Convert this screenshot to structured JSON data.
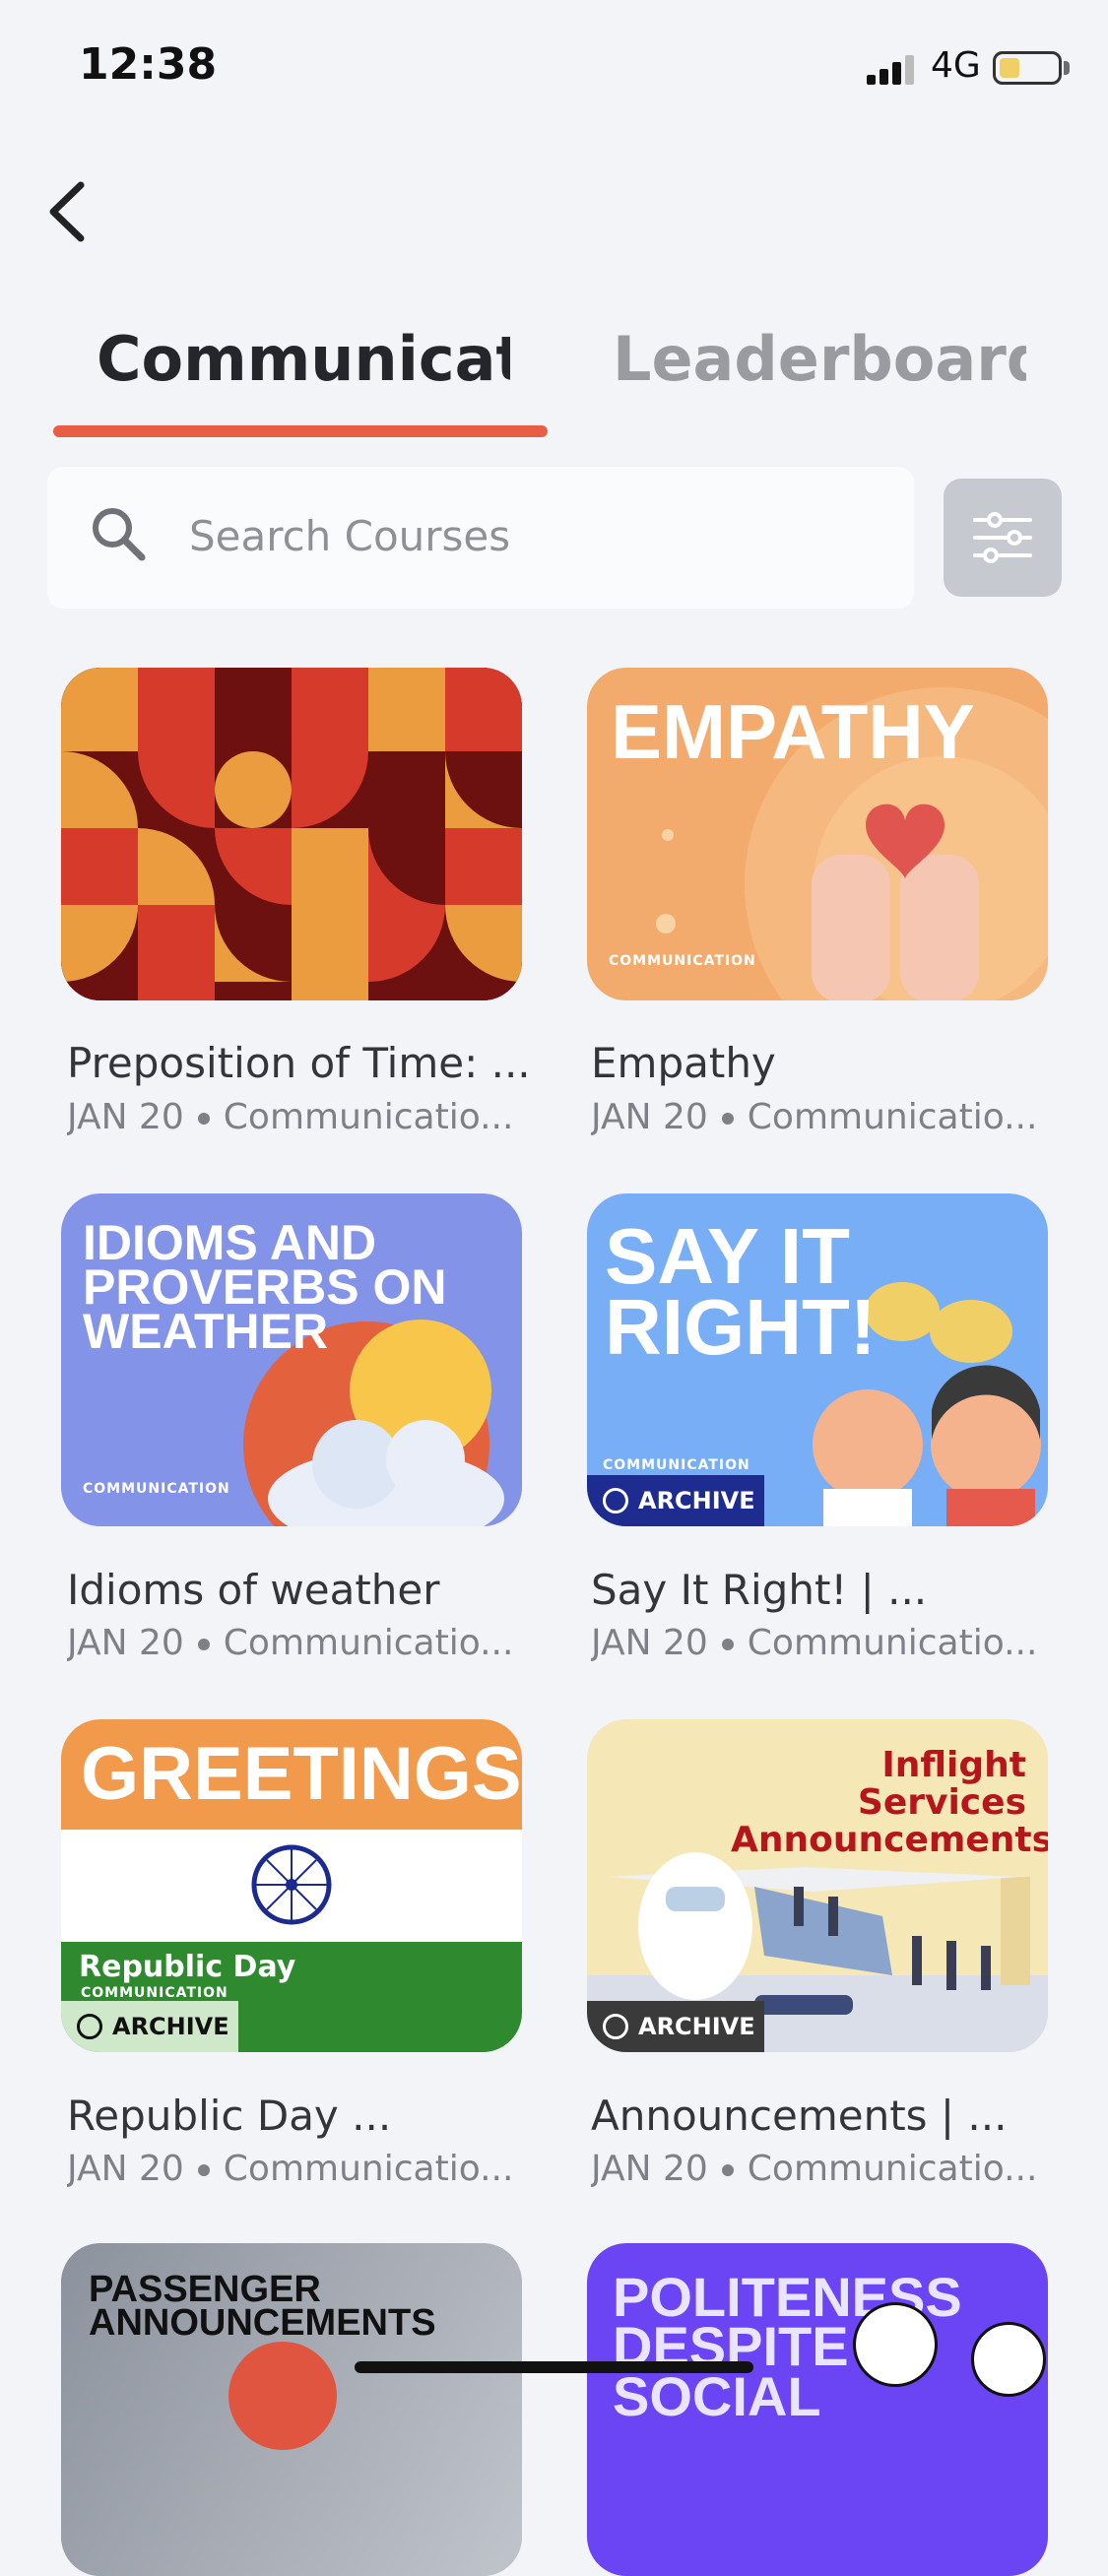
{
  "status": {
    "time": "12:38",
    "network": "4G"
  },
  "tabs": [
    {
      "label": "Communicati",
      "active": true
    },
    {
      "label": "Leaderboard",
      "active": false
    }
  ],
  "search": {
    "placeholder": "Search Courses",
    "value": ""
  },
  "colors": {
    "accent": "#ea5d45",
    "background": "#f3f4f8"
  },
  "courses": [
    {
      "title": "Preposition of Time: ...",
      "date": "JAN 20",
      "category": "Communicatio...",
      "thumb_text": "",
      "badge": ""
    },
    {
      "title": "Empathy",
      "date": "JAN 20",
      "category": "Communicatio...",
      "thumb_text": "EMPATHY",
      "thumb_caption": "COMMUNICATION",
      "badge": ""
    },
    {
      "title": "Idioms of weather",
      "date": "JAN 20",
      "category": "Communicatio...",
      "thumb_text": "IDIOMS AND PROVERBS ON WEATHER",
      "thumb_caption": "COMMUNICATION",
      "badge": ""
    },
    {
      "title": "Say It Right! | ...",
      "date": "JAN 20",
      "category": "Communicatio...",
      "thumb_text": "SAY IT RIGHT!",
      "thumb_caption": "COMMUNICATION",
      "badge": "ARCHIVE"
    },
    {
      "title": "Republic Day ...",
      "date": "JAN 20",
      "category": "Communicatio...",
      "thumb_text": "GREETINGS",
      "thumb_sub": "Republic Day",
      "thumb_caption": "COMMUNICATION",
      "badge": "ARCHIVE"
    },
    {
      "title": "Announcements | ...",
      "date": "JAN 20",
      "category": "Communicatio...",
      "thumb_text": "Inflight Services Announcements",
      "badge": "ARCHIVE"
    },
    {
      "title": "",
      "date": "",
      "category": "",
      "thumb_text": "PASSENGER ANNOUNCEMENTS",
      "badge": ""
    },
    {
      "title": "",
      "date": "",
      "category": "",
      "thumb_text": "POLITENESS DESPITE SOCIAL",
      "badge": ""
    }
  ]
}
